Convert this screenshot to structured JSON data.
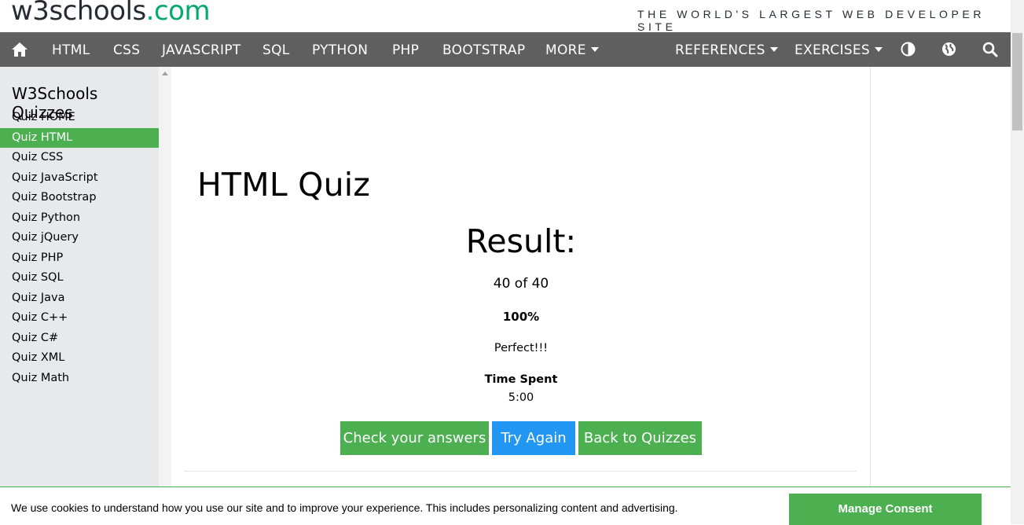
{
  "header": {
    "logo_w3": "w3schools",
    "logo_com": ".com",
    "tagline": "THE WORLD'S LARGEST WEB DEVELOPER SITE"
  },
  "topnav": {
    "home_icon": "home-icon",
    "items": [
      "HTML",
      "CSS",
      "JAVASCRIPT",
      "SQL",
      "PYTHON",
      "PHP",
      "BOOTSTRAP"
    ],
    "more": "MORE",
    "references": "REFERENCES",
    "exercises": "EXERCISES",
    "icons": [
      "contrast-icon",
      "globe-icon",
      "search-icon"
    ]
  },
  "sidebar": {
    "title": "W3Schools Quizzes",
    "items": [
      {
        "label": "Quiz HOME",
        "active": false
      },
      {
        "label": "Quiz HTML",
        "active": true
      },
      {
        "label": "Quiz CSS",
        "active": false
      },
      {
        "label": "Quiz JavaScript",
        "active": false
      },
      {
        "label": "Quiz Bootstrap",
        "active": false
      },
      {
        "label": "Quiz Python",
        "active": false
      },
      {
        "label": "Quiz jQuery",
        "active": false
      },
      {
        "label": "Quiz PHP",
        "active": false
      },
      {
        "label": "Quiz SQL",
        "active": false
      },
      {
        "label": "Quiz Java",
        "active": false
      },
      {
        "label": "Quiz C++",
        "active": false
      },
      {
        "label": "Quiz C#",
        "active": false
      },
      {
        "label": "Quiz XML",
        "active": false
      },
      {
        "label": "Quiz Math",
        "active": false
      }
    ]
  },
  "main": {
    "title": "HTML Quiz",
    "result_title": "Result:",
    "score": "40 of 40",
    "percent": "100%",
    "message": "Perfect!!!",
    "time_label": "Time Spent",
    "time_value": "5:00",
    "buttons": {
      "check": "Check your answers",
      "try_again": "Try Again",
      "back": "Back to Quizzes"
    }
  },
  "cookie": {
    "text": "We use cookies to understand how you use our site and to improve your experience. This includes personalizing content and advertising.",
    "button": "Manage Consent"
  },
  "colors": {
    "green": "#4caf50",
    "blue": "#2196f3",
    "nav_bg": "#5f5f5f",
    "sidebar_bg": "#e7e9eb",
    "logo_green": "#04aa6d"
  }
}
